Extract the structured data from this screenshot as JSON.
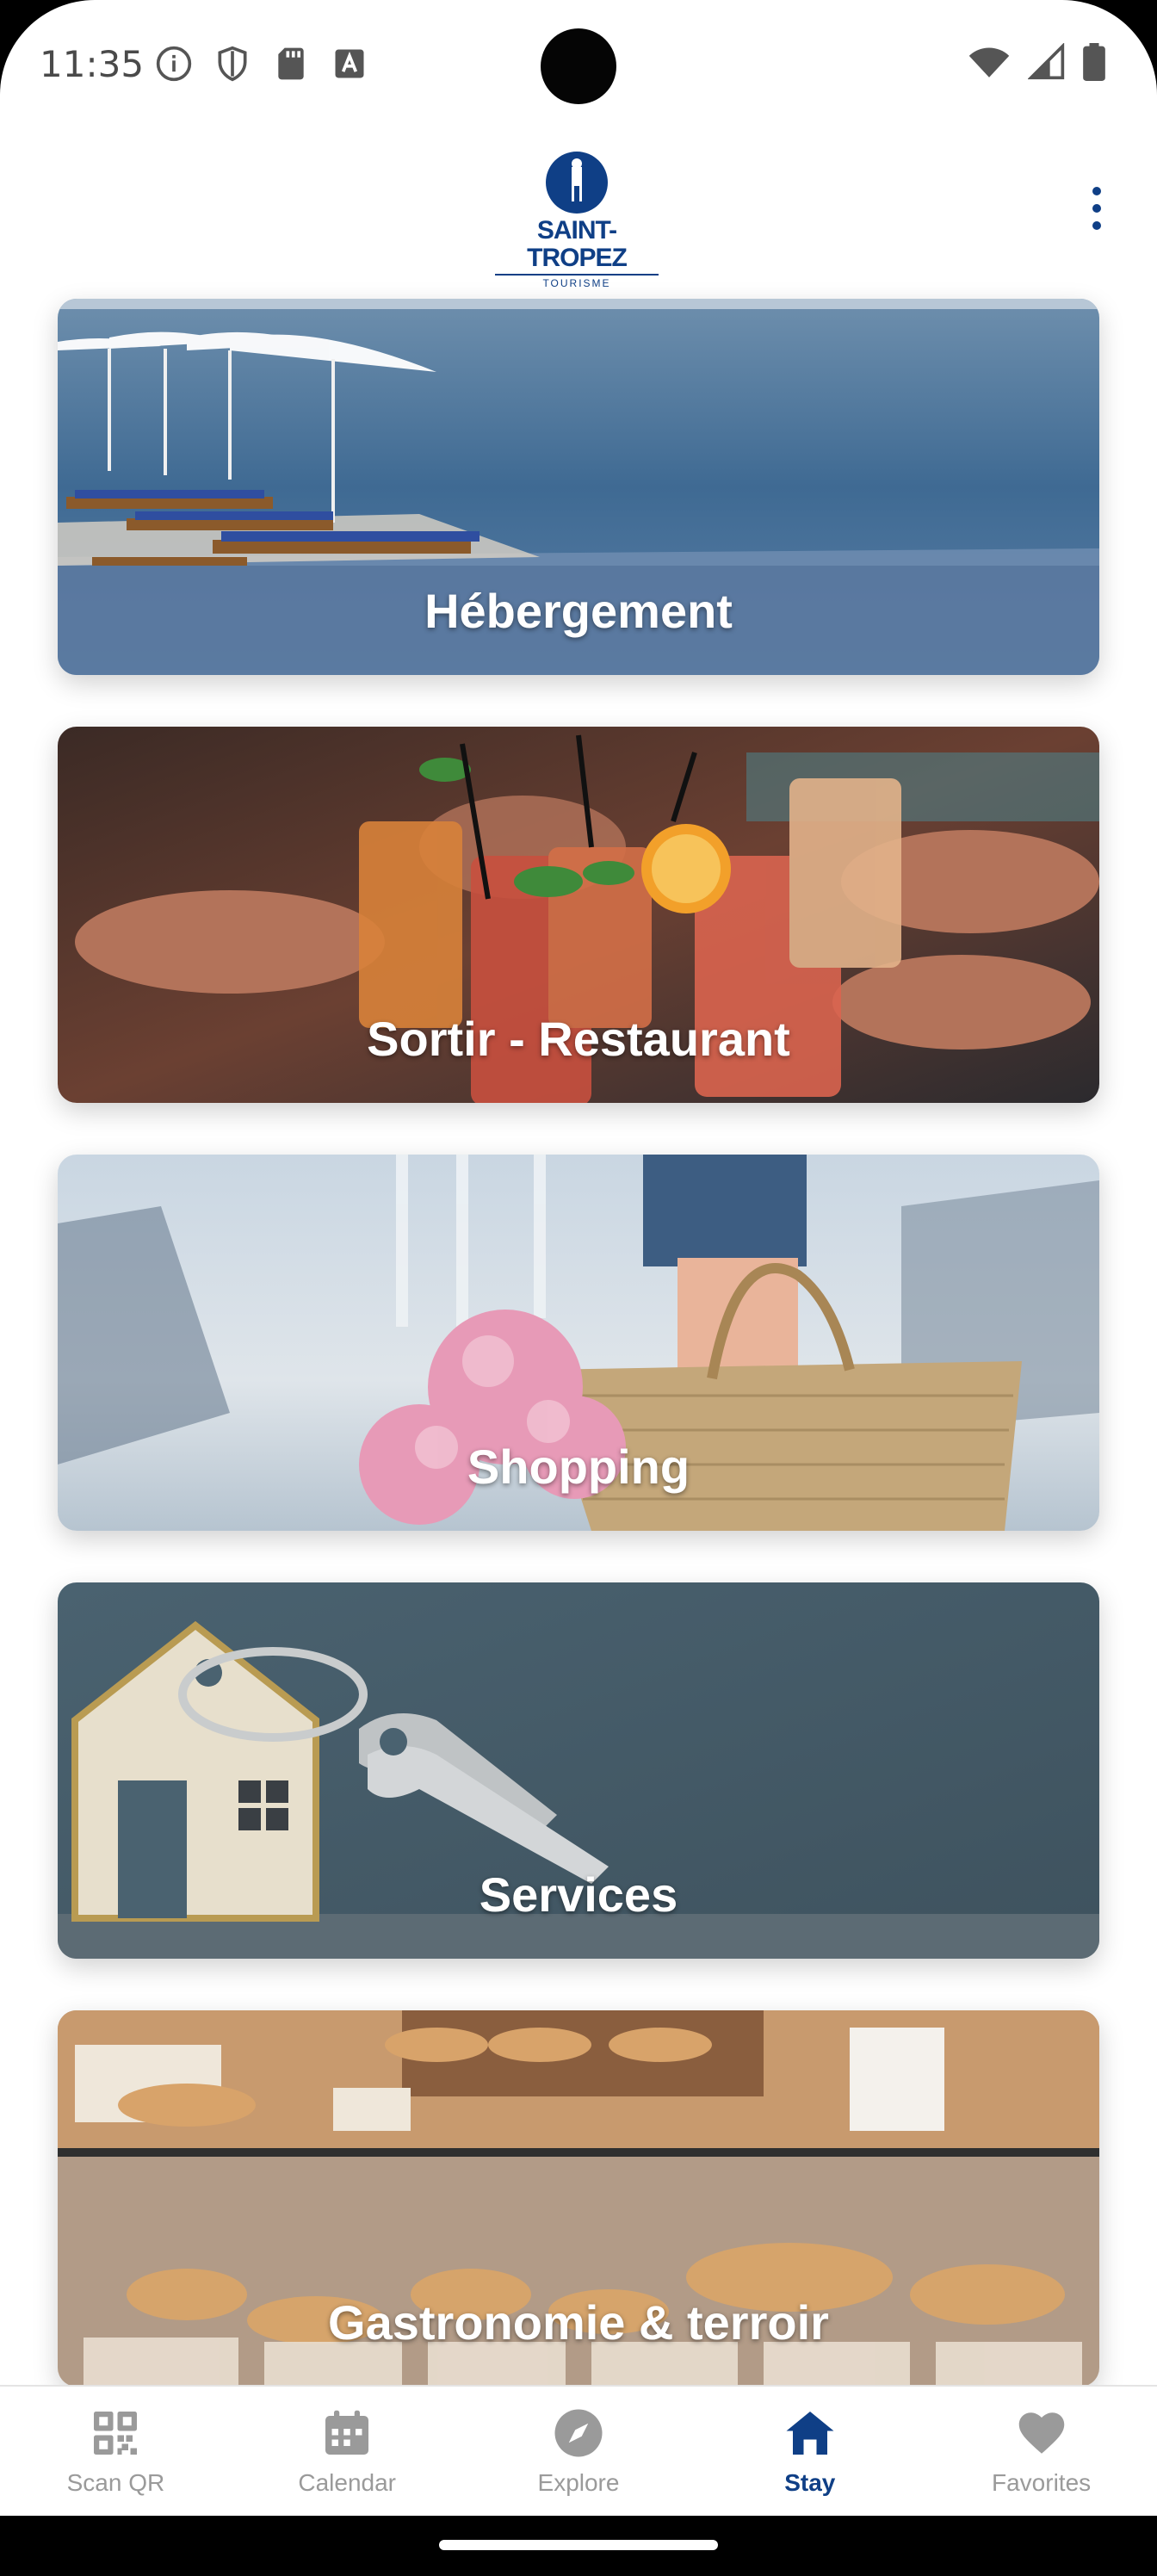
{
  "status_bar": {
    "time": "11:35",
    "left_icons": [
      "info-icon",
      "shield-icon",
      "sd-card-icon",
      "font-a-icon"
    ],
    "right_icons": [
      "wifi-icon",
      "cell-signal-icon",
      "battery-icon"
    ]
  },
  "header": {
    "logo_name": "SAINT-TROPEZ",
    "logo_sub": "TOURISME",
    "menu_icon": "more-vertical-icon",
    "accent_color": "#0f3f86"
  },
  "cards": [
    {
      "label": "Hébergement"
    },
    {
      "label": "Sortir - Restaurant"
    },
    {
      "label": "Shopping"
    },
    {
      "label": "Services"
    },
    {
      "label": "Gastronomie & terroir"
    }
  ],
  "bottom_nav": {
    "items": [
      {
        "label": "Scan QR",
        "icon": "qr-code-icon",
        "active": false
      },
      {
        "label": "Calendar",
        "icon": "calendar-icon",
        "active": false
      },
      {
        "label": "Explore",
        "icon": "compass-icon",
        "active": false
      },
      {
        "label": "Stay",
        "icon": "home-icon",
        "active": true
      },
      {
        "label": "Favorites",
        "icon": "heart-icon",
        "active": false
      }
    ],
    "active_color": "#0f3f86",
    "inactive_color": "#9a9a9a"
  }
}
